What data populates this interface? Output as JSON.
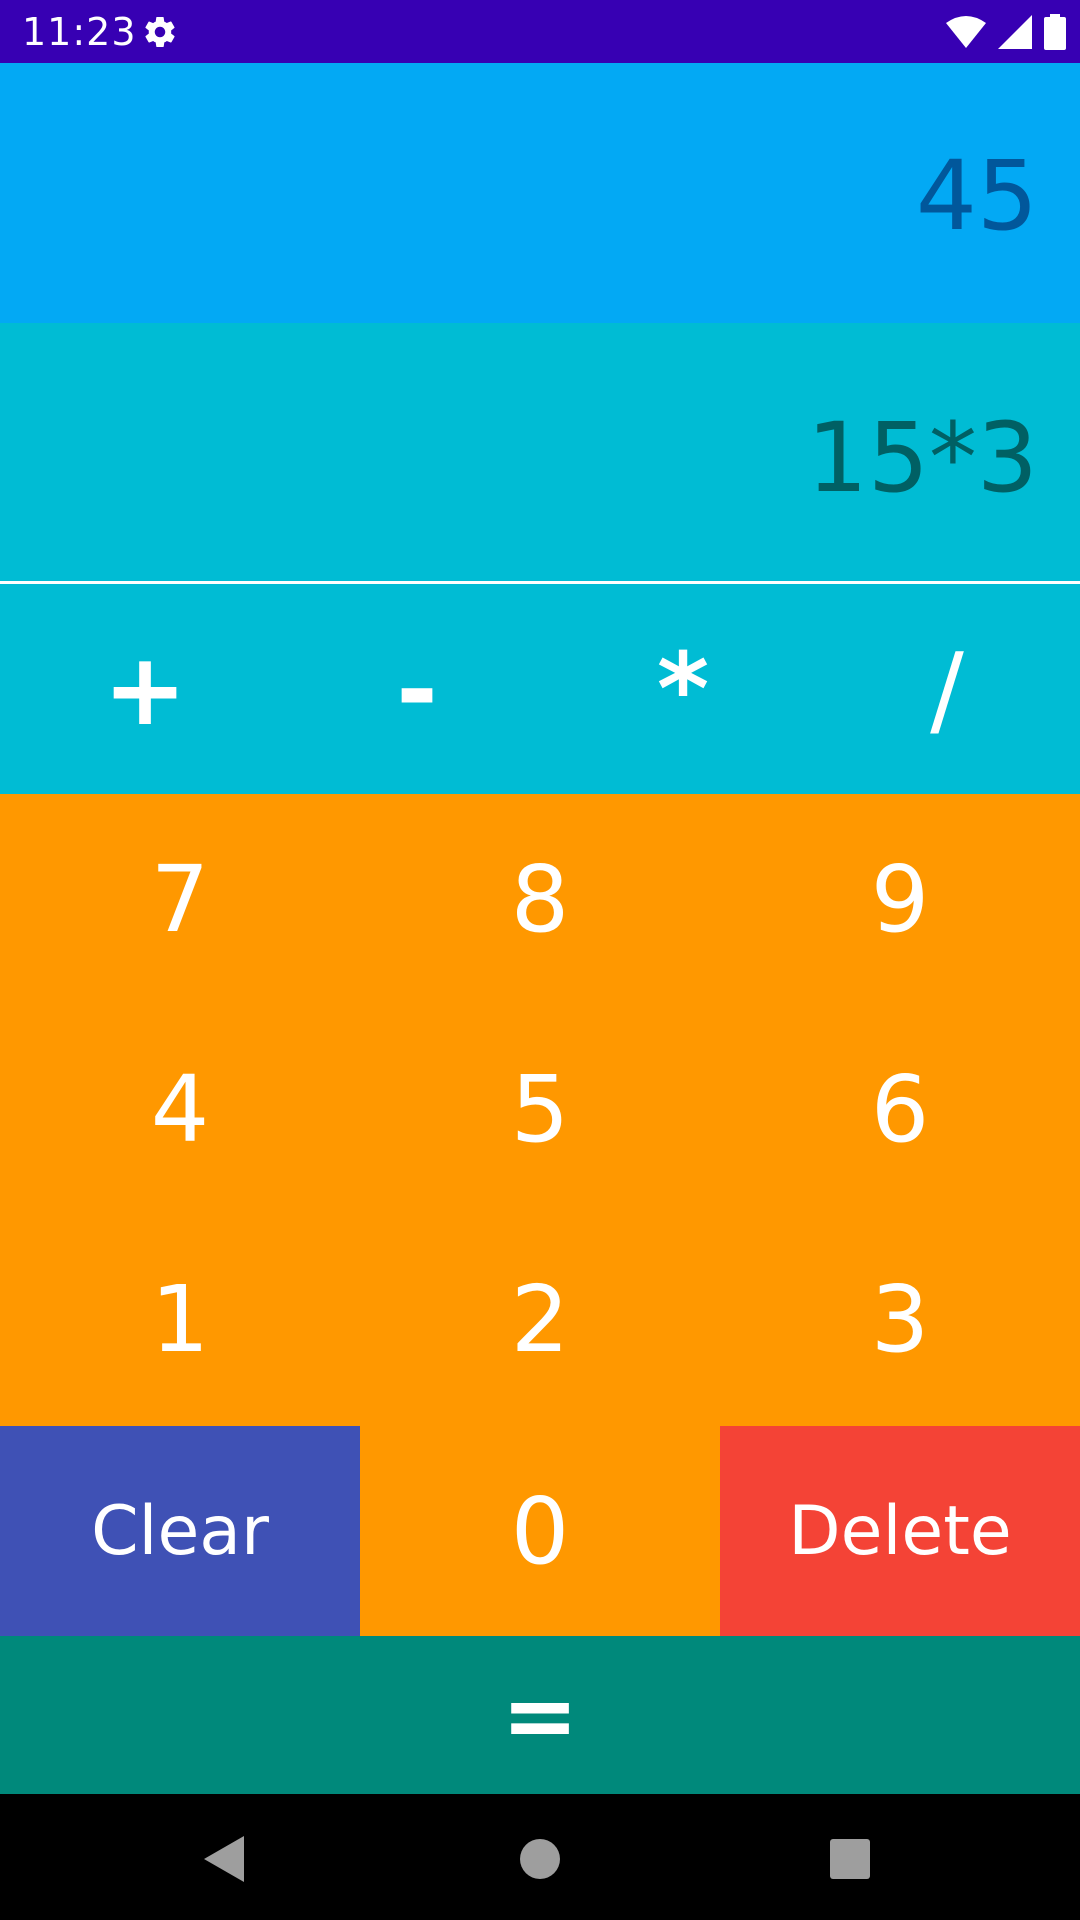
{
  "status_bar": {
    "time": "11:23",
    "icons": [
      "gear-icon",
      "wifi-icon",
      "signal-icon",
      "battery-icon"
    ],
    "background": "#3700b3"
  },
  "display": {
    "result": "45",
    "expression": "15*3",
    "result_color": "#01579b",
    "expression_color": "#006064"
  },
  "operators": [
    "+",
    "-",
    "*",
    "/"
  ],
  "digits": [
    "7",
    "8",
    "9",
    "4",
    "5",
    "6",
    "1",
    "2",
    "3"
  ],
  "bottom_row": {
    "clear": "Clear",
    "zero": "0",
    "delete": "Delete"
  },
  "equals": "=",
  "nav_bar": {
    "icons": [
      "back-icon",
      "home-icon",
      "recents-icon"
    ]
  },
  "colors": {
    "result_bg": "#03a9f4",
    "expression_bg": "#00bcd4",
    "numpad_bg": "#ff9800",
    "clear_bg": "#3f51b5",
    "delete_bg": "#f44336",
    "equals_bg": "#00897b"
  }
}
